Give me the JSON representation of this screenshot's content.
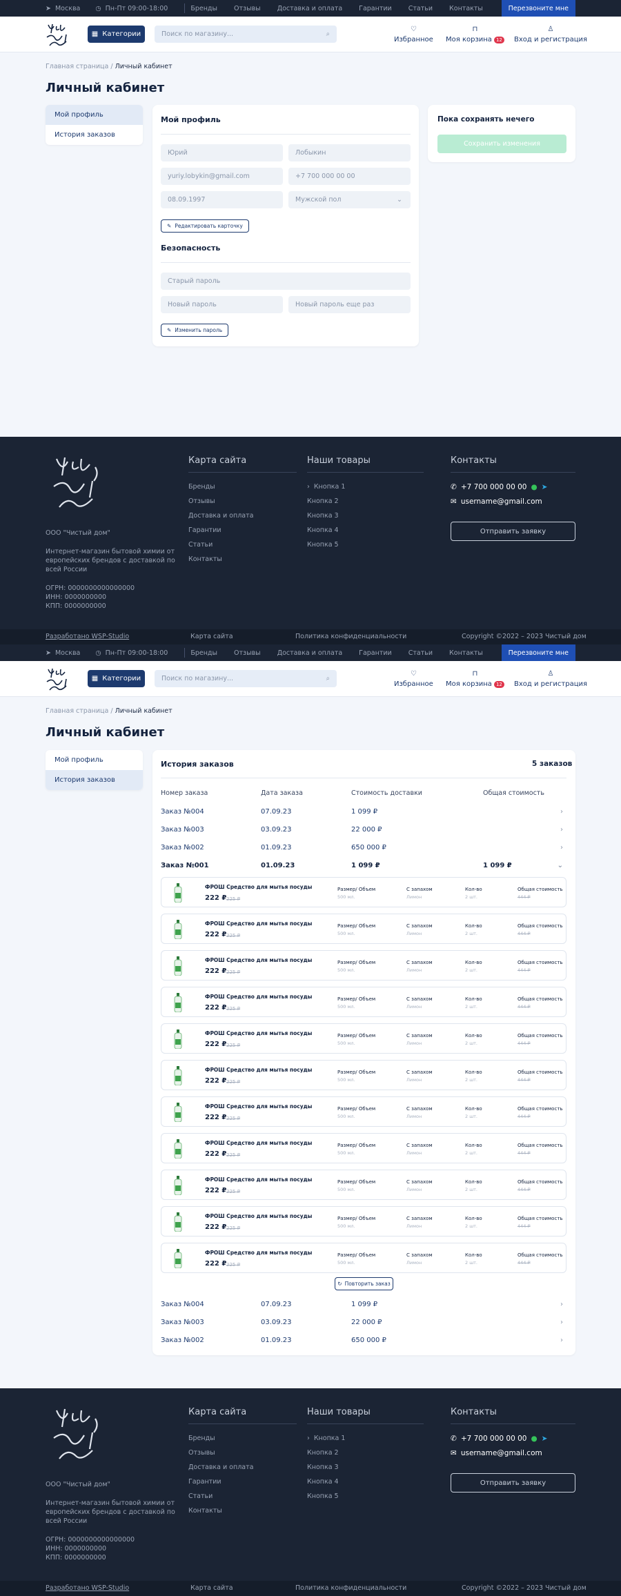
{
  "topbar": {
    "city": "Москва",
    "hours": "Пн-Пт  09:00-18:00",
    "nav": [
      "Бренды",
      "Отзывы",
      "Доставка и оплата",
      "Гарантии",
      "Статьи",
      "Контакты"
    ],
    "callback": "Перезвоните мне"
  },
  "header": {
    "logo_text": "Чистый дом",
    "categories": "Категории",
    "search_placeholder": "Поиск по магазину...",
    "favorites": "Избранное",
    "cart": "Моя корзина",
    "cart_count": "12",
    "login": "Вход и регистрация"
  },
  "breadcrumb": {
    "home": "Главная страница",
    "sep": "/",
    "current": "Личный кабинет"
  },
  "page_title": "Личный кабинет",
  "sidebar": {
    "items": [
      "Мой профиль",
      "История заказов"
    ]
  },
  "profile": {
    "title": "Мой профиль",
    "first_name": "Юрий",
    "last_name": "Лобыкин",
    "email": "yuriy.lobykin@gmail.com",
    "phone": "+7 700 000 00 00",
    "birthdate": "08.09.1997",
    "gender": "Мужской пол",
    "edit_button": "Редактировать карточку",
    "security_title": "Безопасность",
    "old_password": "Старый пароль",
    "new_password": "Новый пароль",
    "new_password_repeat": "Новый пароль еще раз",
    "change_password_button": "Изменить пароль"
  },
  "save_panel": {
    "title": "Пока сохранять нечего",
    "button": "Сохранить изменения"
  },
  "orders": {
    "title": "История заказов",
    "count": "5 заказов",
    "columns": [
      "Номер заказа",
      "Дата заказа",
      "Стоимость доставки",
      "Общая стоимость"
    ],
    "top_rows": [
      {
        "num": "Заказ №004",
        "date": "07.09.23",
        "delivery": "1 099 ₽",
        "total": ""
      },
      {
        "num": "Заказ №003",
        "date": "03.09.23",
        "delivery": "22 000 ₽",
        "total": ""
      },
      {
        "num": "Заказ №002",
        "date": "01.09.23",
        "delivery": "650 000 ₽",
        "total": ""
      }
    ],
    "open_row": {
      "num": "Заказ №001",
      "date": "01.09.23",
      "delivery": "1 099 ₽",
      "total": "1 099 ₽"
    },
    "item": {
      "name": "ФРОШ Средство для мытья посуды",
      "price": "222 ₽",
      "old_price": "225 ₽",
      "size_label": "Размер/ Объем",
      "size_value": "500 мл.",
      "scent_label": "С запахом",
      "scent_value": "Лимон",
      "qty_label": "Кол-во",
      "qty_value": "2 шт.",
      "total_label": "Общая стоимость",
      "total_value": "444 ₽"
    },
    "repeat_button": "Повторить заказ",
    "bottom_rows": [
      {
        "num": "Заказ №004",
        "date": "07.09.23",
        "delivery": "1 099 ₽"
      },
      {
        "num": "Заказ №003",
        "date": "03.09.23",
        "delivery": "22 000 ₽"
      },
      {
        "num": "Заказ №002",
        "date": "01.09.23",
        "delivery": "650 000 ₽"
      }
    ]
  },
  "footer": {
    "company": "ООО \"Чистый дом\"",
    "about_1": "Интернет-магазин бытовой химии от",
    "about_2": "европейских брендов с доставкой по",
    "about_3": "всей России",
    "ogrn": "ОГРН: 0000000000000000",
    "inn": "ИНН: 0000000000",
    "kpp": "КПП: 0000000000",
    "sitemap_title": "Карта сайта",
    "sitemap": [
      "Бренды",
      "Отзывы",
      "Доставка и оплата",
      "Гарантии",
      "Статьи",
      "Контакты"
    ],
    "goods_title": "Наши товары",
    "goods": [
      "Кнопка 1",
      "Кнопка 2",
      "Кнопка 3",
      "Кнопка 4",
      "Кнопка 5"
    ],
    "contacts_title": "Контакты",
    "phone": "+7 700 000 00 00",
    "email": "username@gmail.com",
    "request_button": "Отправить заявку",
    "dev": "Разработано WSP-Studio",
    "sitemap_link": "Карта сайта",
    "privacy": "Политика конфиденциальности",
    "copyright": "Copyright ©2022 – 2023 Чистый дом"
  }
}
